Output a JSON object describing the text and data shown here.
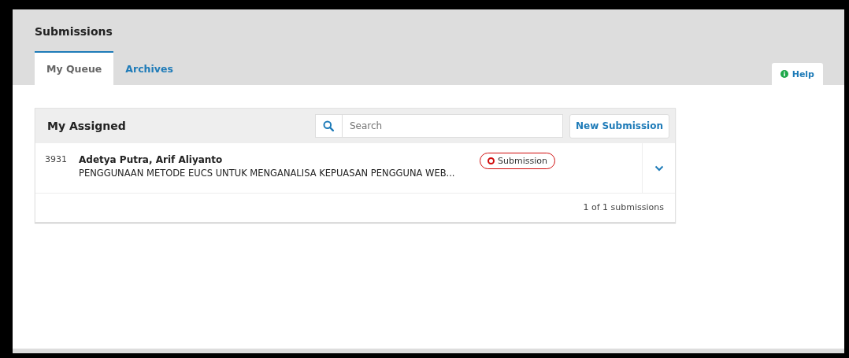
{
  "page": {
    "title": "Submissions"
  },
  "tabs": [
    {
      "label": "My Queue",
      "selected": true
    },
    {
      "label": "Archives",
      "selected": false
    }
  ],
  "help": {
    "label": "Help"
  },
  "panel": {
    "title": "My Assigned",
    "search": {
      "placeholder": "Search"
    },
    "new_button": "New Submission",
    "rows": [
      {
        "id": "3931",
        "authors": "Adetya Putra, Arif Aliyanto",
        "title": "PENGGUNAAN METODE EUCS UNTUK MENGANALISA KEPUASAN PENGGUNA WEB...",
        "stage": "Submission",
        "color": "#d00a0a",
        "expanded": false
      }
    ],
    "footer": "1 of 1 submissions"
  }
}
